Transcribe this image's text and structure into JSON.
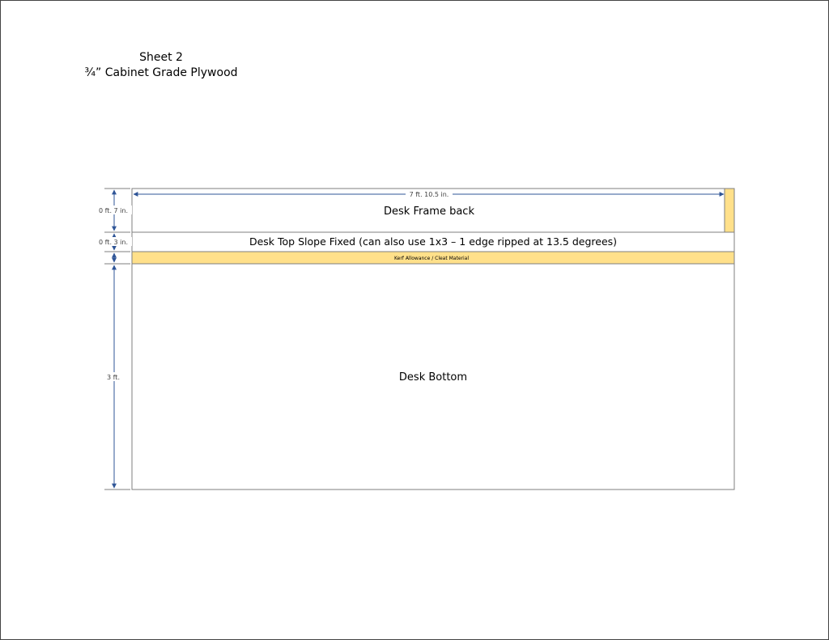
{
  "sheet": {
    "title": "Sheet 2",
    "material": "¾” Cabinet Grade Plywood"
  },
  "dimensions": {
    "width": "7 ft. 10.5 in.",
    "frame_back_height": "0 ft. 7 in.",
    "slope_height": "0 ft. 3 in.",
    "bottom_height": "3 ft."
  },
  "pieces": {
    "frame_back": "Desk Frame back",
    "slope": "Desk Top Slope Fixed (can also use 1x3 – 1 edge ripped at 13.5 degrees)",
    "kerf": "Kerf Allowance / Cleat Material",
    "bottom": "Desk Bottom"
  },
  "colors": {
    "line": "#7f7f7f",
    "arrow": "#2f5597",
    "kerf_fill": "#ffe08a"
  }
}
